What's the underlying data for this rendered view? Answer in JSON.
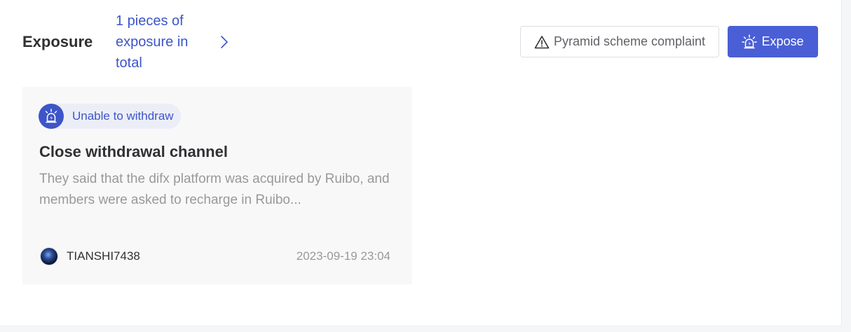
{
  "header": {
    "title": "Exposure",
    "count_link": "1 pieces of exposure in total"
  },
  "actions": {
    "complaint_label": "Pyramid scheme complaint",
    "expose_label": "Expose"
  },
  "card": {
    "tag": "Unable to withdraw",
    "title": "Close withdrawal channel",
    "description": "They said that the difx platform was acquired by Ruibo, and members were asked to recharge in Ruibo...",
    "username": "TIANSHI7438",
    "timestamp": "2023-09-19 23:04"
  },
  "colors": {
    "accent": "#3d55c9",
    "button_primary": "#4a5fd5",
    "card_bg": "#f8f8f9"
  },
  "icons": {
    "warning": "warning-triangle-icon",
    "alarm": "alarm-siren-icon",
    "chevron": "chevron-right-icon"
  }
}
